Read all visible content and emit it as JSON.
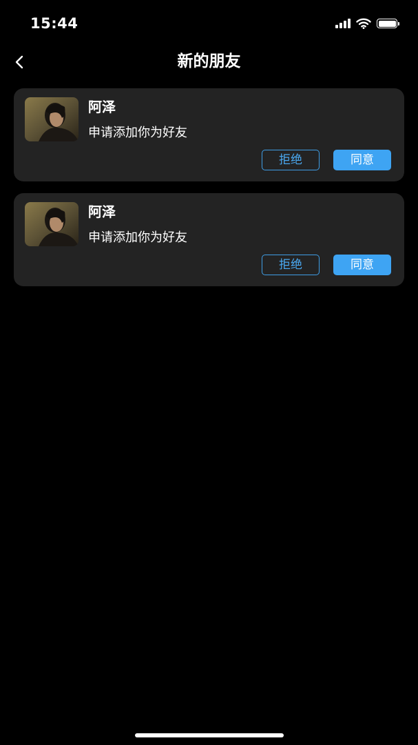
{
  "status_bar": {
    "time": "15:44",
    "icons": [
      "signal-icon",
      "wifi-icon",
      "battery-icon"
    ]
  },
  "header": {
    "back_icon": "chevron-left-icon",
    "title": "新的朋友"
  },
  "requests": [
    {
      "name": "阿泽",
      "message": "申请添加你为好友",
      "reject_label": "拒绝",
      "accept_label": "同意"
    },
    {
      "name": "阿泽",
      "message": "申请添加你为好友",
      "reject_label": "拒绝",
      "accept_label": "同意"
    }
  ],
  "colors": {
    "background": "#000000",
    "card": "#232323",
    "accent": "#3ea4f3",
    "text": "#ffffff"
  }
}
